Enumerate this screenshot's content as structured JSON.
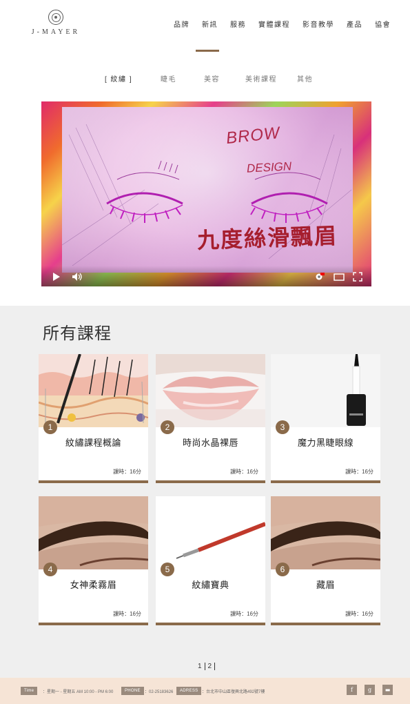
{
  "brand": {
    "logo_text": "J-MAYER"
  },
  "nav": {
    "items": [
      "品牌",
      "新訊",
      "服務",
      "實體課程",
      "影音教學",
      "產品",
      "協會"
    ],
    "active_index": 4,
    "accent_color": "#8a6a4a"
  },
  "category_tabs": {
    "items": [
      "[ 紋繡 ]",
      "睫毛",
      "美容",
      "美術課程",
      "其他"
    ],
    "active_index": 0
  },
  "video": {
    "title_en_1": "BROW",
    "title_en_2": "DESIGN",
    "title_cn": "九度絲滑飄眉",
    "controls": [
      "play-icon",
      "volume-icon",
      "settings-icon",
      "theater-icon",
      "fullscreen-icon"
    ]
  },
  "courses": {
    "section_title": "所有課程",
    "items": [
      {
        "num": "1",
        "title": "紋繡課程概論",
        "duration": "課時：16分",
        "image": "skin-layers"
      },
      {
        "num": "2",
        "title": "時尚水晶裸唇",
        "duration": "課時：16分",
        "image": "lips"
      },
      {
        "num": "3",
        "title": "魔力黑睫眼線",
        "duration": "課時：16分",
        "image": "eyeliner-pen"
      },
      {
        "num": "4",
        "title": "女神柔霧眉",
        "duration": "課時：16分",
        "image": "eyebrow"
      },
      {
        "num": "5",
        "title": "紋繡寶典",
        "duration": "課時：16分",
        "image": "tattoo-pen"
      },
      {
        "num": "6",
        "title": "藏眉",
        "duration": "課時：16分",
        "image": "eyebrow"
      }
    ]
  },
  "pagination": {
    "pages": [
      "1",
      "2"
    ],
    "current": "2"
  },
  "footer": {
    "time_label": "Time",
    "time_value": "：星期一 - 星期五 AM 10:00 - PM 6:00",
    "phone_label": "PHONE",
    "phone_value": "：02-25183626",
    "address_label": "ADRESS",
    "address_value": "：台北市中山區復興北路492號7樓",
    "social": [
      "f",
      "g",
      "▬"
    ]
  }
}
